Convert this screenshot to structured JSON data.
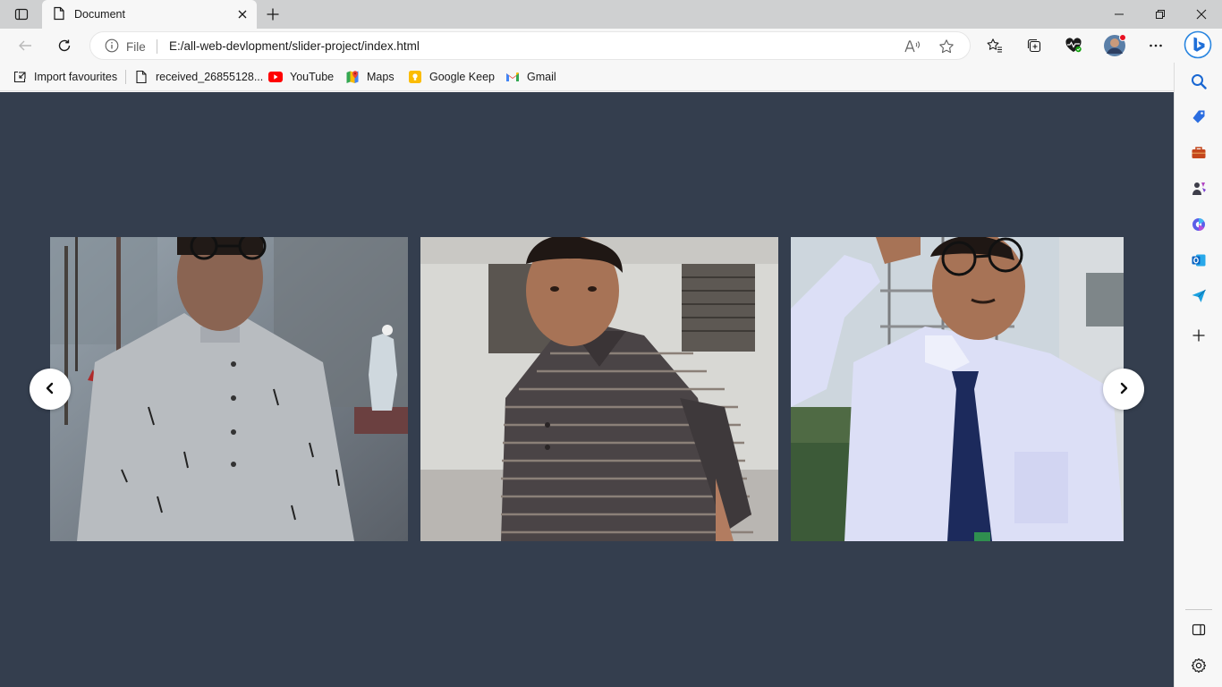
{
  "browser": {
    "tab": {
      "title": "Document"
    },
    "address": {
      "scheme_label": "File",
      "url": "E:/all-web-devlopment/slider-project/index.html"
    },
    "favorites": [
      {
        "label": "Import favourites",
        "icon": "import-icon"
      },
      {
        "label": "received_26855128...",
        "icon": "page-icon"
      },
      {
        "label": "YouTube",
        "icon": "youtube-icon",
        "color": "#ff0000"
      },
      {
        "label": "Maps",
        "icon": "maps-icon"
      },
      {
        "label": "Google Keep",
        "icon": "keep-icon",
        "color": "#fbbc04"
      },
      {
        "label": "Gmail",
        "icon": "gmail-icon"
      }
    ],
    "sidebar_icons": [
      "search-icon",
      "shopping-icon",
      "tools-icon",
      "games-icon",
      "office-icon",
      "outlook-icon",
      "send-icon",
      "add-icon",
      "split-screen-icon",
      "settings-icon"
    ]
  },
  "page": {
    "background": "#343e4e",
    "slider": {
      "prev_icon": "chevron-left-icon",
      "next_icon": "chevron-right-icon",
      "slides": [
        {
          "name": "photo-grey-kurta",
          "shirt_color": "#b8bcc0"
        },
        {
          "name": "photo-striped-polo",
          "shirt_color": "#4a4446"
        },
        {
          "name": "photo-white-shirt-tie",
          "shirt_color": "#dcdff6"
        }
      ]
    }
  }
}
